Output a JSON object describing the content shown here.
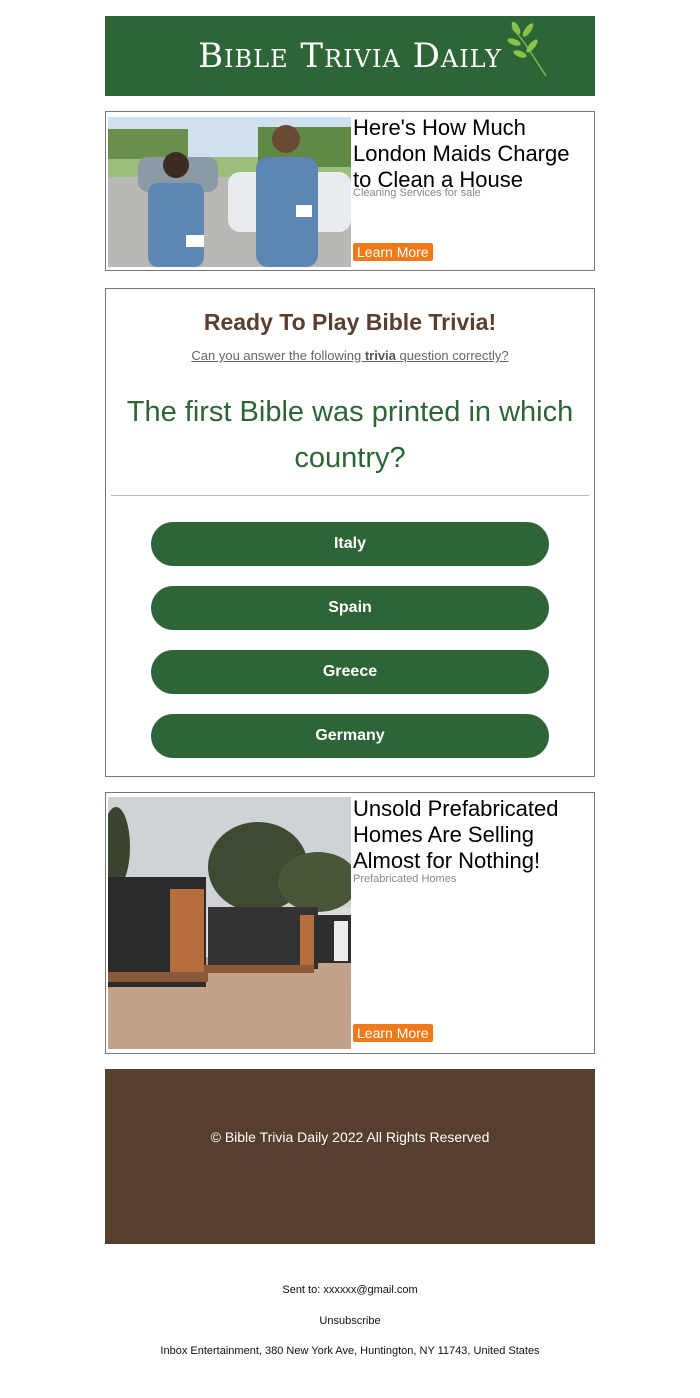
{
  "header": {
    "brand": "Bible Trivia Daily"
  },
  "ad1": {
    "title": "Here's How Much London Maids Charge to Clean a House",
    "sponsor": "Cleaning Services for sale",
    "button": "Learn More"
  },
  "quiz": {
    "heading": "Ready To Play Bible Trivia!",
    "sub_before": "Can you answer the following ",
    "sub_bold": "trivia",
    "sub_after": " question correctly?",
    "question": "The first Bible was printed in which country?",
    "answers": [
      "Italy",
      "Spain",
      "Greece",
      "Germany"
    ]
  },
  "ad2": {
    "title": "Unsold Prefabricated Homes Are Selling Almost for Nothing!",
    "sponsor": "Prefabricated Homes",
    "button": "Learn More"
  },
  "footer": {
    "copyright": "© Bible Trivia Daily 2022 All Rights Reserved"
  },
  "meta": {
    "sent_to": "Sent to: xxxxxx@gmail.com",
    "unsubscribe": "Unsubscribe",
    "address": "Inbox Entertainment, 380 New York Ave, Huntington, NY 11743, United States"
  },
  "colors": {
    "brand_green": "#2e6537",
    "footer_brown": "#573f30",
    "cta_orange": "#f07a1a"
  }
}
